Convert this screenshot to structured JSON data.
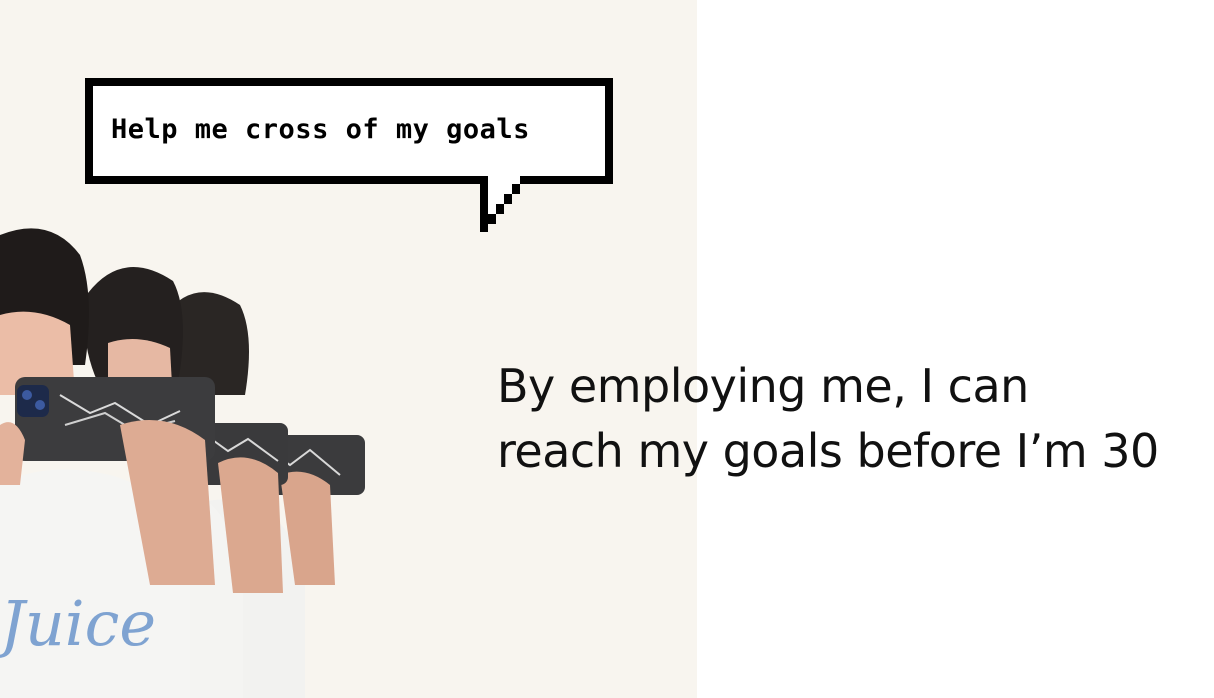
{
  "bubble": {
    "text": "Help me cross of my goals"
  },
  "headline": {
    "line1": "By employing me, I can",
    "line2": "reach my goals before I’m 30"
  },
  "photo": {
    "shirt_text": "Juice"
  },
  "colors": {
    "panel_background": "#f8f5ef",
    "page_background": "#ffffff",
    "text": "#111111",
    "bubble_border": "#000000"
  }
}
